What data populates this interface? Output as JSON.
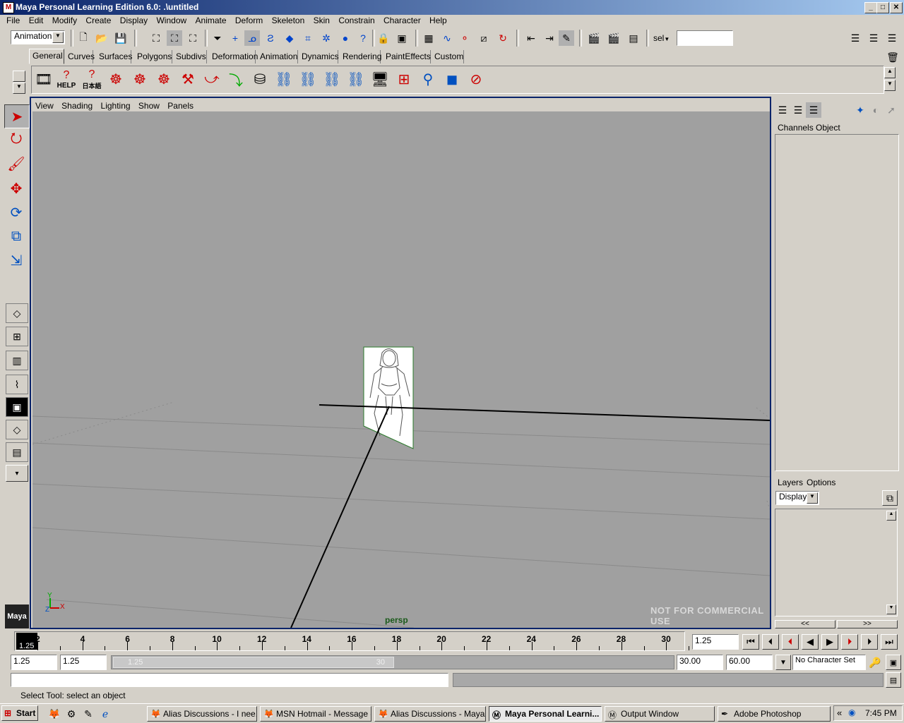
{
  "window": {
    "title": "Maya Personal Learning Edition 6.0: .\\untitled",
    "app_icon": "M",
    "controls": [
      "_",
      "□",
      "✕"
    ]
  },
  "menubar": [
    "File",
    "Edit",
    "Modify",
    "Create",
    "Display",
    "Window",
    "Animate",
    "Deform",
    "Skeleton",
    "Skin",
    "Constrain",
    "Character",
    "Help"
  ],
  "statusline": {
    "menuset": "Animation",
    "sel_label": "sel",
    "sel_value": ""
  },
  "shelf": {
    "tabs": [
      "General",
      "Curves",
      "Surfaces",
      "Polygons",
      "Subdivs",
      "Deformation",
      "Animation",
      "Dynamics",
      "Rendering",
      "PaintEffects",
      "Custom"
    ],
    "active_tab": "General",
    "help_text": "HELP",
    "japanese_text": "日本語"
  },
  "panel": {
    "menu": [
      "View",
      "Shading",
      "Lighting",
      "Show",
      "Panels"
    ],
    "camera_label": "persp",
    "watermark": "NOT FOR COMMERCIAL USE",
    "axis_x": "X",
    "axis_y": "Y",
    "axis_z": "Z",
    "logo": "Maya"
  },
  "channelbox": {
    "menu": [
      "Channels",
      "Object"
    ],
    "layers_menu": [
      "Layers",
      "Options"
    ],
    "layer_mode": "Display",
    "scroll_left": "<<",
    "scroll_right": ">>"
  },
  "timeslider": {
    "ticks": [
      "2",
      "4",
      "6",
      "8",
      "10",
      "12",
      "14",
      "16",
      "18",
      "20",
      "22",
      "24",
      "26",
      "28",
      "30"
    ],
    "current_time_marker": "1.25",
    "current_time": "1.25"
  },
  "rangeslider": {
    "start_time": "1.25",
    "range_start": "1.25",
    "bar_start": "1.25",
    "bar_end": "30",
    "range_end": "30.00",
    "end_time": "60.00",
    "character_set": "No Character Set"
  },
  "helpline": {
    "text": "Select Tool: select an object"
  },
  "taskbar": {
    "start": "Start",
    "buttons": [
      {
        "label": "Alias Discussions - I nee...",
        "icon": "firefox-icon"
      },
      {
        "label": "MSN Hotmail - Message -...",
        "icon": "firefox-icon"
      },
      {
        "label": "Alias Discussions - Maya ...",
        "icon": "firefox-icon"
      },
      {
        "label": "Maya Personal Learni...",
        "icon": "maya-icon",
        "active": true
      },
      {
        "label": "Output Window",
        "icon": "maya-icon"
      },
      {
        "label": "Adobe Photoshop",
        "icon": "photoshop-icon"
      }
    ],
    "tray_collapse": "«",
    "clock": "7:45 PM"
  },
  "colors": {
    "title_active": "#0a246a",
    "viewport_bg": "#a0a0a0",
    "panel_border": "#0a246a",
    "camera_label": "#1a5a1a"
  }
}
